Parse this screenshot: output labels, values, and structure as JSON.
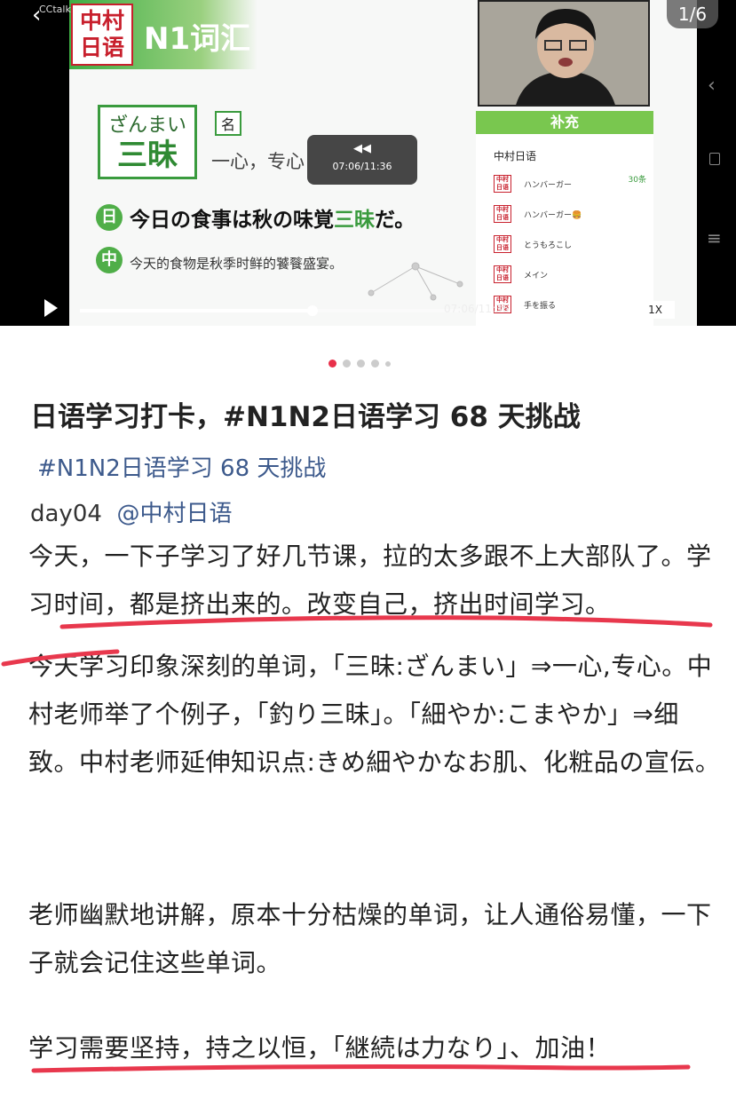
{
  "media": {
    "app_label": "CCtalk",
    "back_glyph": "‹",
    "page_counter": "1/6",
    "slide": {
      "logo_lines": [
        "中村",
        "日语"
      ],
      "title": "N1词汇",
      "word_reading": "ざんまい",
      "word_kanji": "三昧",
      "pos": "名",
      "meaning": "一心，专心",
      "jp_icon": "日",
      "jp_sentence_before": "今日の食事は秋の味覚",
      "jp_sentence_highlight": "三昧",
      "jp_sentence_after": "だ。",
      "cn_icon": "中",
      "cn_sentence": "今天的食物是秋季时鲜的饕餮盛宴。"
    },
    "side_panel": {
      "header": "补充",
      "channel": "中村日语",
      "count": "30条",
      "items": [
        "ハンバーガー",
        "ハンバーガー🍔",
        "とうもろこし",
        "メイン",
        "手を振る"
      ]
    },
    "tooltip": {
      "icon": "◀◀",
      "time": "07:06/11:36"
    },
    "controls": {
      "progress": 0.61,
      "time": "07:06/11:36",
      "seek_label": "▶▶ 5\"",
      "speed_label": "1X"
    },
    "side_icons": {
      "arrow": "‹",
      "menu": "≡"
    }
  },
  "carousel": {
    "count": 5,
    "active": 0
  },
  "post": {
    "title": "日语学习打卡，#N1N2日语学习 68 天挑战",
    "hashtag": "#N1N2日语学习 68 天挑战",
    "day": "day04",
    "mention": "@中村日语",
    "p1": "今天，一下子学习了好几节课，拉的太多跟不上大部队了。学习时间，都是挤出来的。改变自己，挤出时间学习。",
    "p2": "今天学习印象深刻的单词，「三昧:ざんまい」⇒一心,专心。中村老师举了个例子，「釣り三昧」。「細やか:こまやか」⇒细致。中村老师延伸知识点:きめ細やかなお肌、化粧品の宣伝。",
    "p3": "老师幽默地讲解，原本十分枯燥的单词，让人通俗易懂，一下子就会记住这些单词。",
    "p4": "学习需要坚持，持之以恒，「継続は力なり」、加油！"
  },
  "colors": {
    "underline": "#e8384d",
    "brand_green": "#3a9b3e",
    "link": "#3d5a8c",
    "dot_active": "#e8304a"
  }
}
